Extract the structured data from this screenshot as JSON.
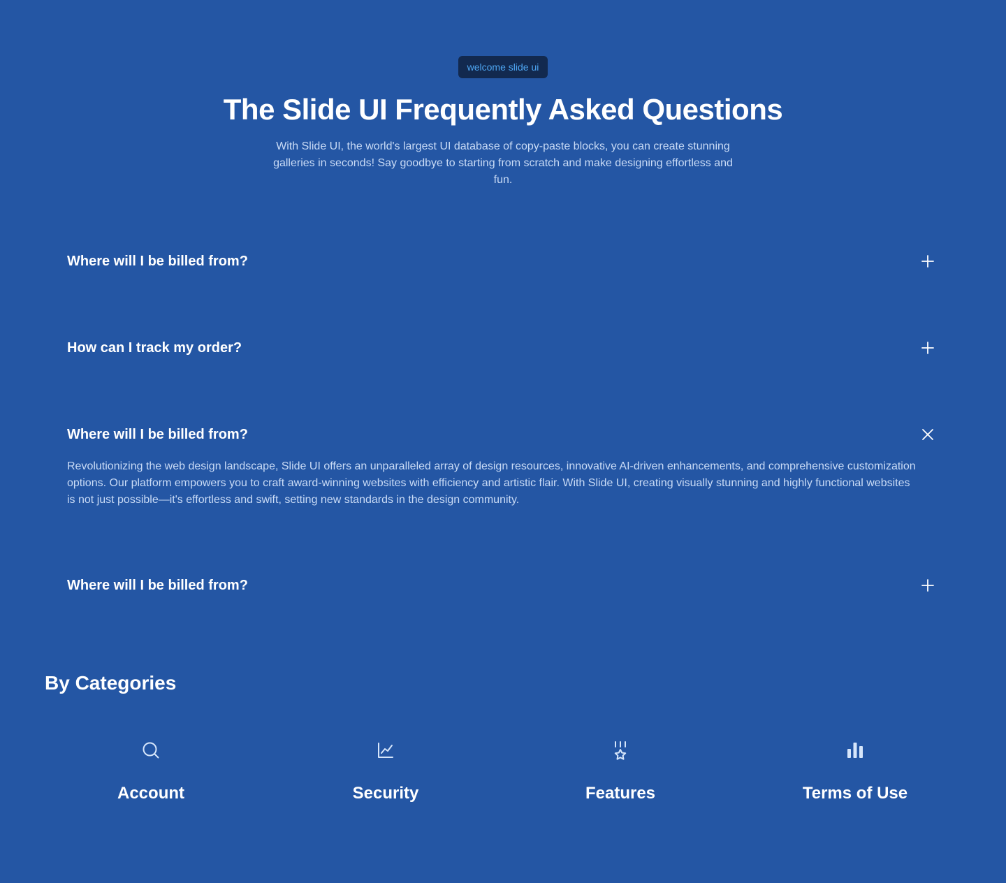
{
  "hero": {
    "badge": "welcome slide ui",
    "title": "The Slide UI Frequently Asked Questions",
    "subtitle": "With Slide UI, the world's largest UI database of copy-paste blocks, you can create stunning galleries in seconds! Say goodbye to starting from scratch and make designing effortless and fun."
  },
  "faq": {
    "items": [
      {
        "question": "Where will I be billed from?",
        "state": "collapsed",
        "toggle_icon": "plus-icon"
      },
      {
        "question": "How can I track my order?",
        "state": "collapsed",
        "toggle_icon": "plus-icon"
      },
      {
        "question": "Where will I be billed from?",
        "state": "expanded",
        "toggle_icon": "close-icon",
        "answer": "Revolutionizing the web design landscape, Slide UI offers an unparalleled array of design resources, innovative AI-driven enhancements, and comprehensive customization options. Our platform empowers you to craft award-winning websites with efficiency and artistic flair. With Slide UI, creating visually stunning and highly functional websites is not just possible—it's effortless and swift, setting new standards in the design community."
      },
      {
        "question": "Where will I be billed from?",
        "state": "collapsed",
        "toggle_icon": "plus-icon"
      }
    ]
  },
  "categories": {
    "title": "By Categories",
    "items": [
      {
        "label": "Account",
        "icon": "search-icon"
      },
      {
        "label": "Security",
        "icon": "line-chart-icon"
      },
      {
        "label": "Features",
        "icon": "award-icon"
      },
      {
        "label": "Terms of Use",
        "icon": "bar-chart-icon"
      }
    ]
  },
  "colors": {
    "background": "#2456a4",
    "badge_background": "#12294f",
    "badge_text": "#4ea6f2",
    "muted_text": "#c9dbf6",
    "icon": "#d6e6fb"
  }
}
